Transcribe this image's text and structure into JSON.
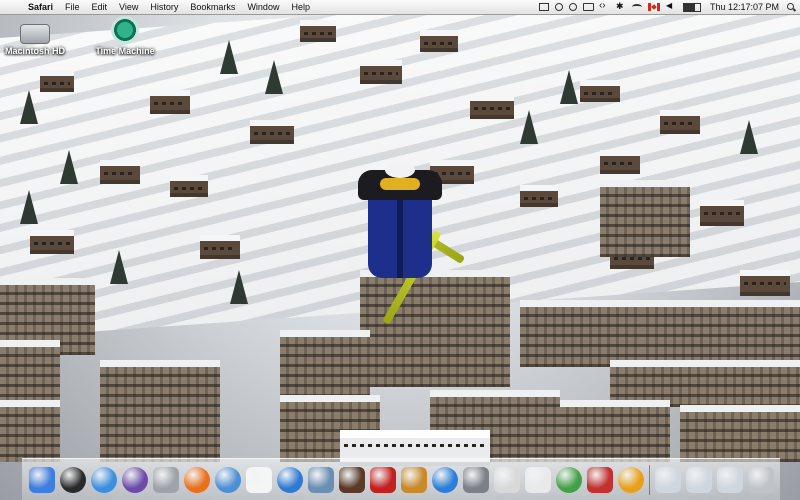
{
  "menubar": {
    "apple": "",
    "app_name": "Safari",
    "items": [
      "File",
      "Edit",
      "View",
      "History",
      "Bookmarks",
      "Window",
      "Help"
    ],
    "clock": "Thu 12:17:07 PM"
  },
  "desktop": {
    "icons": [
      {
        "label": "Macintosh HD",
        "icon": "hard-drive-icon"
      },
      {
        "label": "Time Machine",
        "icon": "time-machine-icon"
      }
    ]
  },
  "dock": {
    "items": [
      {
        "name": "finder",
        "color": "#3d7ee0"
      },
      {
        "name": "dashboard",
        "color": "#2a2a2a"
      },
      {
        "name": "safari",
        "color": "#3c8fe0"
      },
      {
        "name": "itunes-radio",
        "color": "#6c4aa8"
      },
      {
        "name": "calculator",
        "color": "#9da3a9"
      },
      {
        "name": "firefox",
        "color": "#e8701a"
      },
      {
        "name": "mail",
        "color": "#4d8fd6"
      },
      {
        "name": "ical",
        "color": "#f5f5f5"
      },
      {
        "name": "itunes",
        "color": "#2f79d3"
      },
      {
        "name": "iphoto",
        "color": "#6a8fb3"
      },
      {
        "name": "photo-booth",
        "color": "#5a3a2a"
      },
      {
        "name": "flashcards",
        "color": "#c42020"
      },
      {
        "name": "garageband",
        "color": "#c98a2a"
      },
      {
        "name": "ichat",
        "color": "#2b7fd8"
      },
      {
        "name": "system-preferences",
        "color": "#7c8188"
      },
      {
        "name": "address-book",
        "color": "#d9d9d9"
      },
      {
        "name": "textedit",
        "color": "#e9e9e9"
      },
      {
        "name": "windows-media-player",
        "color": "#43a047"
      },
      {
        "name": "crossover",
        "color": "#c23030"
      },
      {
        "name": "vlc",
        "color": "#e8a018"
      },
      {
        "name": "documents-folder",
        "color": "#cfd6de"
      },
      {
        "name": "downloads-folder",
        "color": "#cfd6de"
      },
      {
        "name": "applications-folder",
        "color": "#cfd6de"
      },
      {
        "name": "trash",
        "color": "#bfc4c9"
      }
    ]
  }
}
